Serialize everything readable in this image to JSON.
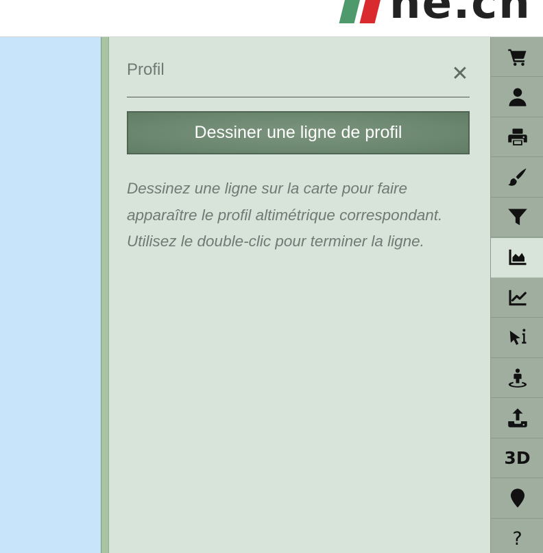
{
  "header": {
    "logo_text": "ne.ch",
    "logo_icon": "ne-flag-logo"
  },
  "panel": {
    "title": "Profil",
    "close_icon": "close-icon",
    "draw_button_label": "Dessiner une ligne de profil",
    "help_text": "Dessinez une ligne sur la carte pour faire apparaître le profil altimétrique correspondant. Utilisez le double-clic pour terminer la ligne."
  },
  "toolbar": {
    "items": [
      {
        "icon": "cart-icon"
      },
      {
        "icon": "user-icon"
      },
      {
        "icon": "print-icon"
      },
      {
        "icon": "brush-icon"
      },
      {
        "icon": "filter-icon"
      },
      {
        "icon": "area-chart-icon",
        "active": true
      },
      {
        "icon": "line-chart-icon"
      },
      {
        "icon": "pointer-info-icon"
      },
      {
        "icon": "street-view-icon"
      },
      {
        "icon": "upload-icon"
      },
      {
        "icon": "3d-icon",
        "label": "3D"
      },
      {
        "icon": "map-marker-icon"
      },
      {
        "icon": "help-icon",
        "label": "?"
      }
    ]
  },
  "colors": {
    "map_water": "#c8e4fb",
    "panel_bg": "#d8e4d9",
    "toolbar_bg": "#a0aea0",
    "button_bg": "#6d8871",
    "logo_green": "#4e9a6c",
    "logo_red": "#d92b2f"
  }
}
